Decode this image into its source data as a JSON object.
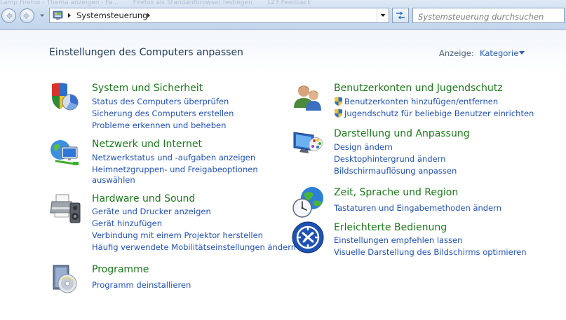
{
  "window": {
    "ghost_tabs": [
      "Lamp Firefox - Thema anzeigen - Fa...",
      "Firefox als Standardbrowser festlegen",
      "123 Feedback"
    ]
  },
  "address_bar": {
    "path": "Systemsteuerung",
    "icon": "control-panel-icon"
  },
  "search": {
    "placeholder": "Systemsteuerung durchsuchen"
  },
  "page": {
    "title": "Einstellungen des Computers anpassen",
    "view_label": "Anzeige:",
    "view_value": "Kategorie"
  },
  "categories": {
    "system": {
      "title": "System und Sicherheit",
      "icon": "shield-pie-icon",
      "links": [
        "Status des Computers überprüfen",
        "Sicherung des Computers erstellen",
        "Probleme erkennen und beheben"
      ]
    },
    "network": {
      "title": "Netzwerk und Internet",
      "icon": "network-globe-icon",
      "links": [
        "Netzwerkstatus und -aufgaben anzeigen",
        "Heimnetzgruppen- und Freigabeoptionen",
        "auswählen"
      ]
    },
    "hardware": {
      "title": "Hardware und Sound",
      "icon": "printer-speaker-icon",
      "links": [
        "Geräte und Drucker anzeigen",
        "Gerät hinzufügen",
        "Verbindung mit einem Projektor herstellen",
        "Häufig verwendete Mobilitätseinstellungen ändern"
      ]
    },
    "programs": {
      "title": "Programme",
      "icon": "programs-disc-icon",
      "links": [
        "Programm deinstallieren"
      ]
    },
    "users": {
      "title": "Benutzerkonten und Jugendschutz",
      "icon": "users-icon",
      "links": [
        "Benutzerkonten hinzufügen/entfernen",
        "Jugendschutz für beliebige Benutzer einrichten"
      ]
    },
    "appearance": {
      "title": "Darstellung und Anpassung",
      "icon": "monitor-palette-icon",
      "links": [
        "Design ändern",
        "Desktophintergrund ändern",
        "Bildschirmauflösung anpassen"
      ]
    },
    "clock": {
      "title": "Zeit, Sprache und Region",
      "icon": "clock-globe-icon",
      "links": [
        "Tastaturen und Eingabemethoden ändern"
      ]
    },
    "access": {
      "title": "Erleichterte Bedienung",
      "icon": "ease-of-access-icon",
      "links": [
        "Einstellungen empfehlen lassen",
        "Visuelle Darstellung des Bildschirms optimieren"
      ]
    }
  },
  "colors": {
    "category_title": "#1c7a1c",
    "link": "#2151b8",
    "page_title": "#1e395b"
  }
}
